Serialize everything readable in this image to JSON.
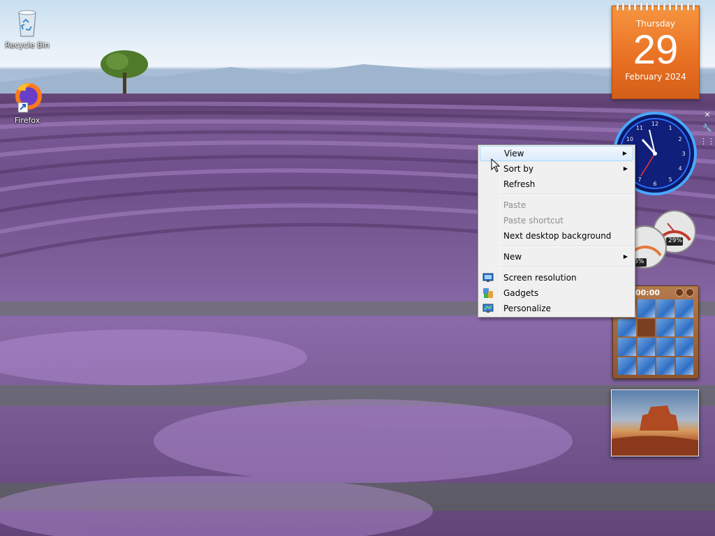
{
  "desktop": {
    "icons": [
      {
        "label": "Recycle Bin",
        "icon": "recycle-bin-icon"
      },
      {
        "label": "Firefox",
        "icon": "firefox-icon"
      }
    ]
  },
  "calendar": {
    "weekday": "Thursday",
    "day": "29",
    "month_year": "February 2024"
  },
  "cpu_meter": {
    "cpu_label": "6%",
    "memory_label": "29%"
  },
  "puzzle": {
    "timer": "00:00"
  },
  "context_menu": {
    "items": [
      {
        "label": "View",
        "has_submenu": true,
        "highlighted": true
      },
      {
        "label": "Sort by",
        "has_submenu": true
      },
      {
        "label": "Refresh"
      },
      {
        "label": "Paste",
        "disabled": true
      },
      {
        "label": "Paste shortcut",
        "disabled": true
      },
      {
        "label": "Next desktop background"
      },
      {
        "label": "New",
        "has_submenu": true
      },
      {
        "label": "Screen resolution",
        "icon": "screen-resolution-icon"
      },
      {
        "label": "Gadgets",
        "icon": "gadgets-icon"
      },
      {
        "label": "Personalize",
        "icon": "personalize-icon"
      }
    ],
    "submenu_arrow": "▶"
  },
  "colors": {
    "calendar_orange": "#e86f22",
    "menu_bg": "#f0f0f0",
    "menu_highlight": "#dcebfc"
  }
}
